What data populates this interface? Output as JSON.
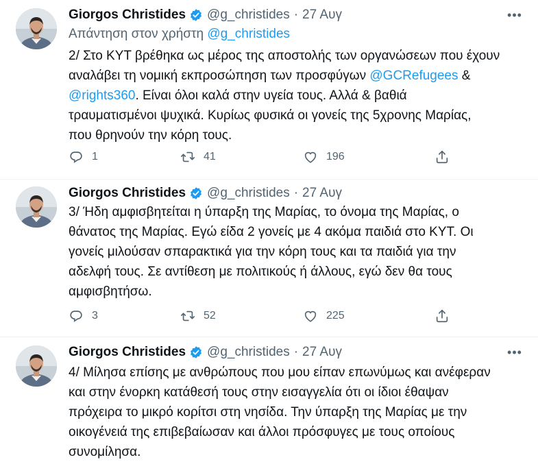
{
  "tweets": [
    {
      "name": "Giorgos Christides",
      "handle": "@g_christides",
      "dot": "·",
      "date": "27 Αυγ",
      "replying_prefix": "Απάντηση στον χρήστη",
      "replying_handle": "@g_christides",
      "lines": [
        {
          "pre": "2/ Στο ΚΥΤ βρέθηκα ως μέρος της αποστολής των οργανώσεων που έχουν",
          "link": "",
          "post": ""
        },
        {
          "pre": "αναλάβει τη νομική εκπροσώπηση των προσφύγων ",
          "link": "@GCRefugees",
          "post": " &"
        },
        {
          "pre": "",
          "link": "@rights360",
          "post": ". Είναι όλοι καλά στην υγεία τους. Αλλά & βαθιά"
        },
        {
          "pre": "τραυματισμένοι ψυχικά. Κυρίως φυσικά οι γονείς της 5χρονης Μαρίας,",
          "link": "",
          "post": ""
        },
        {
          "pre": "που θρηνούν την κόρη τους.",
          "link": "",
          "post": ""
        }
      ],
      "replies": "1",
      "retweets": "41",
      "likes": "196"
    },
    {
      "name": "Giorgos Christides",
      "handle": "@g_christides",
      "dot": "·",
      "date": "27 Αυγ",
      "lines": [
        {
          "pre": "3/ Ήδη αμφισβητείται η ύπαρξη της Μαρίας, το όνομα της Μαρίας, ο",
          "link": "",
          "post": ""
        },
        {
          "pre": "θάνατος της Μαρίας. Εγώ είδα 2 γονείς με 4 ακόμα παιδιά στο ΚΥΤ. Οι",
          "link": "",
          "post": ""
        },
        {
          "pre": "γονείς μιλούσαν σπαρακτικά για την κόρη τους και τα παιδιά για την",
          "link": "",
          "post": ""
        },
        {
          "pre": "αδελφή τους. Σε αντίθεση με πολιτικούς ή άλλους, εγώ δεν θα τους",
          "link": "",
          "post": ""
        },
        {
          "pre": "αμφισβητήσω.",
          "link": "",
          "post": ""
        }
      ],
      "replies": "3",
      "retweets": "52",
      "likes": "225"
    },
    {
      "name": "Giorgos Christides",
      "handle": "@g_christides",
      "dot": "·",
      "date": "27 Αυγ",
      "lines": [
        {
          "pre": "4/ Μίλησα επίσης με ανθρώπους που μου είπαν επωνύμως και ανέφεραν",
          "link": "",
          "post": ""
        },
        {
          "pre": "και στην ένορκη κατάθεσή τους στην εισαγγελία ότι οι ίδιοι έθαψαν",
          "link": "",
          "post": ""
        },
        {
          "pre": "πρόχειρα το μικρό κορίτσι στη νησίδα. Την ύπαρξη της Μαρίας με την",
          "link": "",
          "post": ""
        },
        {
          "pre": "οικογένειά της επιβεβαίωσαν και άλλοι πρόσφυγες με τους οποίους",
          "link": "",
          "post": ""
        },
        {
          "pre": "συνομίλησα.",
          "link": "",
          "post": ""
        }
      ]
    }
  ],
  "colors": {
    "link": "#1d9bf0",
    "secondary_text": "#536471",
    "primary_text": "#0f1419",
    "divider": "#eff3f4"
  },
  "icons": {
    "verified": "verified-badge-icon",
    "more": "more-options-icon",
    "reply": "reply-icon",
    "retweet": "retweet-icon",
    "like": "like-icon",
    "share": "share-icon"
  }
}
